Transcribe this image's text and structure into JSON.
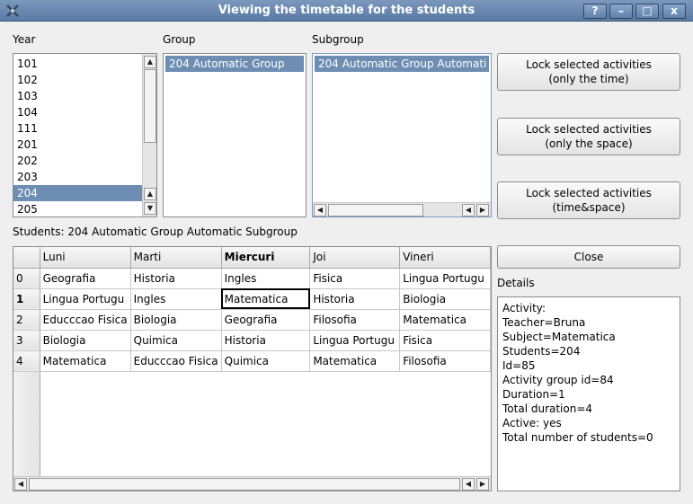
{
  "window": {
    "title": "Viewing the timetable for the students",
    "buttons": {
      "help": "?",
      "minimize": "–",
      "maximize": "□",
      "close": "x"
    }
  },
  "labels": {
    "year": "Year",
    "group": "Group",
    "subgroup": "Subgroup",
    "students": "Students: 204 Automatic Group Automatic Subgroup",
    "details": "Details"
  },
  "years": [
    "101",
    "102",
    "103",
    "104",
    "111",
    "201",
    "202",
    "203",
    "204",
    "205"
  ],
  "selected_year": "204",
  "groups": [
    "204 Automatic Group"
  ],
  "subgroups": [
    "204 Automatic Group Automati"
  ],
  "buttons": {
    "lock_time": [
      "Lock selected activities",
      "(only the time)"
    ],
    "lock_space": [
      "Lock selected activities",
      "(only the space)"
    ],
    "lock_both": [
      "Lock selected activities",
      "(time&space)"
    ],
    "close": "Close"
  },
  "timetable": {
    "columns": [
      "Luni",
      "Marti",
      "Miercuri",
      "Joi",
      "Vineri"
    ],
    "current_column": "Miercuri",
    "current_row": "1",
    "rows": [
      {
        "label": "0",
        "cells": [
          "Geografia",
          "Historia",
          "Ingles",
          "Fisica",
          "Lingua Portugu"
        ]
      },
      {
        "label": "1",
        "cells": [
          "Lingua Portugu",
          "Ingles",
          "Matematica",
          "Historia",
          "Biologia"
        ]
      },
      {
        "label": "2",
        "cells": [
          "Educccao Fisica",
          "Biologia",
          "Geografia",
          "Filosofia",
          "Matematica"
        ]
      },
      {
        "label": "3",
        "cells": [
          "Biologia",
          "Quimica",
          "Historia",
          "Lingua Portugu",
          "Fisica"
        ]
      },
      {
        "label": "4",
        "cells": [
          "Matematica",
          "Educccao Fisica",
          "Quimica",
          "Matematica",
          "Filosofia"
        ]
      }
    ]
  },
  "details_lines": [
    "Activity:",
    "Teacher=Bruna",
    "Subject=Matematica",
    "Students=204",
    "Id=85",
    "Activity group id=84",
    "Duration=1",
    "Total duration=4",
    "Active: yes",
    "Total number of students=0"
  ],
  "icons": {
    "app": "fet-logo-icon",
    "scroll_up": "▲",
    "scroll_down": "▼",
    "scroll_left": "◀",
    "scroll_right": "▶"
  },
  "colors": {
    "selection": "#6d8db3",
    "titlebar": "#6a89b2"
  }
}
